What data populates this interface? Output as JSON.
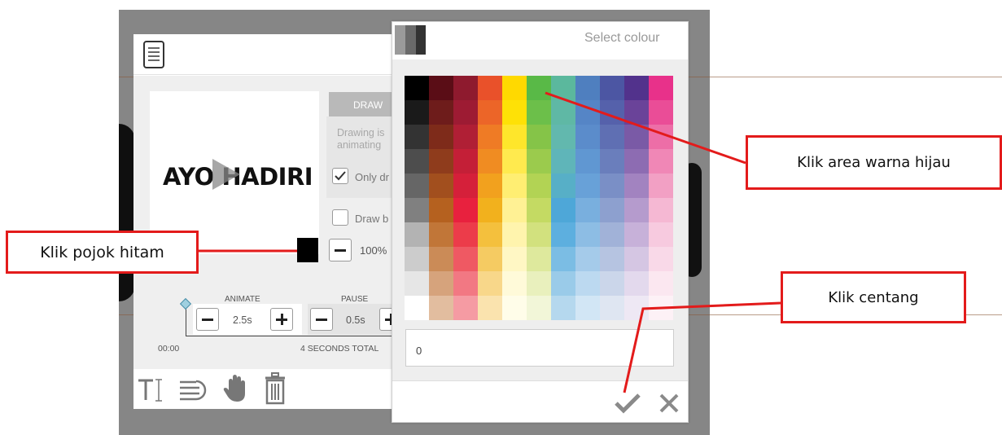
{
  "editor": {
    "preview_text": "AYO HADIRI",
    "draw_tab_label": "DRAW",
    "draw_description": "Drawing is\nanimating",
    "only_checkbox_label": "Only dr",
    "draw_b_checkbox_label": "Draw b",
    "zoom_value": "100%",
    "timeline": {
      "animate_label": "ANIMATE",
      "animate_value": "2.5s",
      "pause_label": "PAUSE",
      "pause_value": "0.5s",
      "start_time": "00:00",
      "total_label": "4 SECONDS TOTAL"
    },
    "toolbar_icons": [
      "text-cursor-icon",
      "align-icon",
      "hand-icon",
      "trash-icon"
    ]
  },
  "colour_picker": {
    "title": "Select colour",
    "input_value": "0",
    "palette": [
      [
        "#000000",
        "#5a0d16",
        "#8e1a2e",
        "#e9512a",
        "#ffd900",
        "#59b947",
        "#5bb89d",
        "#4f7fbf",
        "#4c56a3",
        "#52328c",
        "#e8318a"
      ],
      [
        "#1a1a1a",
        "#6e1c1b",
        "#9d1b33",
        "#ec6528",
        "#fee106",
        "#6cbf4a",
        "#5fb8a5",
        "#5585c6",
        "#5561ab",
        "#6a4399",
        "#ea4d97"
      ],
      [
        "#333333",
        "#7e2b1a",
        "#b01f35",
        "#ef7b25",
        "#fee62b",
        "#85c448",
        "#62b8ae",
        "#5b8ccb",
        "#5f6fb3",
        "#7a5aa6",
        "#ed6ea7"
      ],
      [
        "#4d4d4d",
        "#8f3c1c",
        "#c41f37",
        "#f08c22",
        "#ffea4e",
        "#9bcb4d",
        "#5fb5b9",
        "#6097d2",
        "#6a7ebc",
        "#8d6cb2",
        "#f087b6"
      ],
      [
        "#666666",
        "#a24f1e",
        "#d5203a",
        "#f2a11e",
        "#ffee72",
        "#b2d354",
        "#57afc7",
        "#68a1d8",
        "#7a8fc6",
        "#a283c0",
        "#f2a0c4"
      ],
      [
        "#808080",
        "#b5611f",
        "#e8213e",
        "#f2b11d",
        "#fff194",
        "#c4da63",
        "#4ea7d8",
        "#79afde",
        "#8da0cf",
        "#b59bcd",
        "#f5b8d3"
      ],
      [
        "#b3b3b3",
        "#c17638",
        "#ec3c4a",
        "#f4c03d",
        "#fff4ad",
        "#d2e17e",
        "#5dafdf",
        "#8dbde4",
        "#a1b2d8",
        "#c7b1d9",
        "#f7cadf"
      ],
      [
        "#cccccc",
        "#cb8b57",
        "#ef5963",
        "#f5cb62",
        "#fff7c4",
        "#dee99d",
        "#7bbde4",
        "#a5cbea",
        "#b6c4e1",
        "#d5c6e3",
        "#f9d9e8"
      ],
      [
        "#e6e6e6",
        "#d6a37c",
        "#f27883",
        "#f8d78a",
        "#fffad9",
        "#e9f0bd",
        "#9acbe9",
        "#bcd9f0",
        "#cbd6ea",
        "#e3d9ed",
        "#fbe7f0"
      ],
      [
        "#ffffff",
        "#e2bd9f",
        "#f59ba3",
        "#fae3ae",
        "#fffde9",
        "#f2f6d8",
        "#b5d8ee",
        "#d2e6f5",
        "#dfe6f2",
        "#eee8f4",
        "#fdf1f6"
      ]
    ]
  },
  "annotations": {
    "green_area": "Klik area warna hijau",
    "black_corner": "Klik pojok hitam",
    "checkmark": "Klik centang"
  },
  "colors": {
    "annotation_red": "#e31b1b",
    "backdrop_gray": "#868686"
  }
}
